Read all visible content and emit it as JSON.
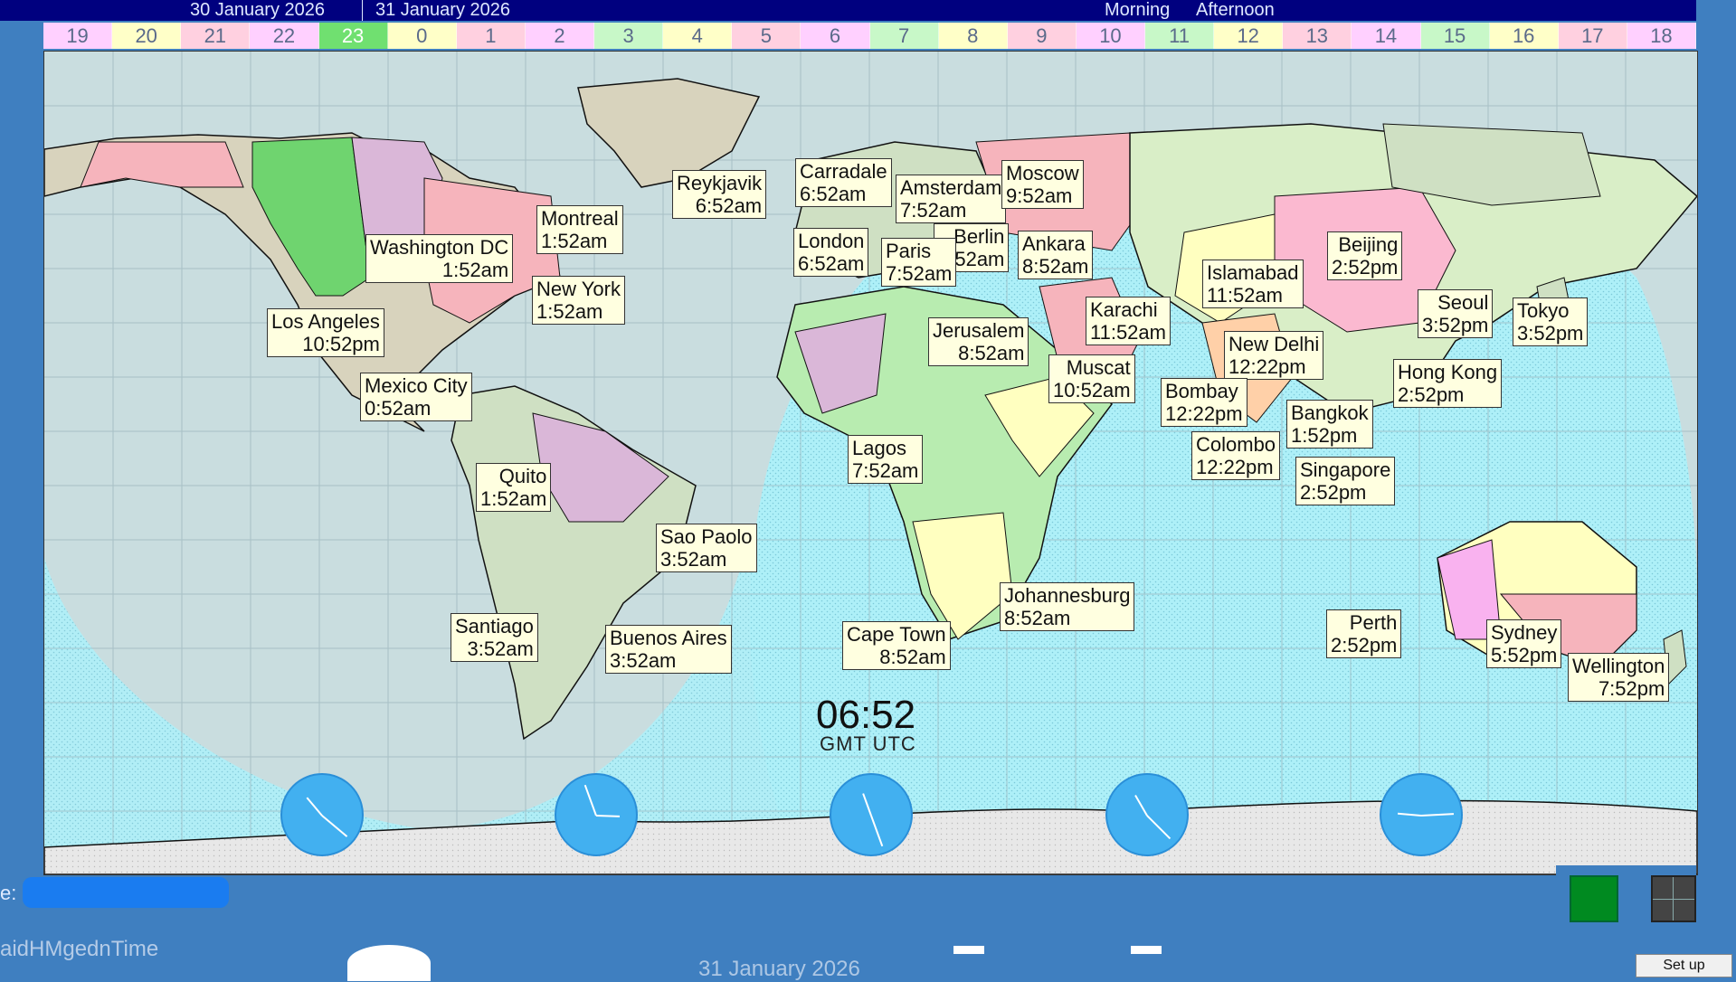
{
  "header": {
    "date_left": "30 January 2026",
    "date_right": "31 January 2026",
    "period_morning": "Morning",
    "period_afternoon": "Afternoon"
  },
  "hour_strip": [
    "19",
    "20",
    "21",
    "22",
    "23",
    "0",
    "1",
    "2",
    "3",
    "4",
    "5",
    "6",
    "7",
    "8",
    "9",
    "10",
    "11",
    "12",
    "13",
    "14",
    "15",
    "16",
    "17",
    "18"
  ],
  "cities": [
    {
      "name": "Reykjavik",
      "time": "6:52am"
    },
    {
      "name": "Carradale",
      "time": "6:52am"
    },
    {
      "name": "Amsterdam",
      "time": "7:52am"
    },
    {
      "name": "Moscow",
      "time": "9:52am"
    },
    {
      "name": "Montreal",
      "time": "1:52am"
    },
    {
      "name": "Washington DC",
      "time": "1:52am"
    },
    {
      "name": "New York",
      "time": "1:52am"
    },
    {
      "name": "Los Angeles",
      "time": "10:52pm"
    },
    {
      "name": "Mexico City",
      "time": "0:52am"
    },
    {
      "name": "London",
      "time": "6:52am"
    },
    {
      "name": "Paris",
      "time": "7:52am"
    },
    {
      "name": "Berlin",
      "time": "7:52am"
    },
    {
      "name": "Ankara",
      "time": "8:52am"
    },
    {
      "name": "Jerusalem",
      "time": "8:52am"
    },
    {
      "name": "Karachi",
      "time": "11:52am"
    },
    {
      "name": "Islamabad",
      "time": "11:52am"
    },
    {
      "name": "Beijing",
      "time": "2:52pm"
    },
    {
      "name": "Seoul",
      "time": "3:52pm"
    },
    {
      "name": "Tokyo",
      "time": "3:52pm"
    },
    {
      "name": "New Delhi",
      "time": "12:22pm"
    },
    {
      "name": "Muscat",
      "time": "10:52am"
    },
    {
      "name": "Bombay",
      "time": "12:22pm"
    },
    {
      "name": "Hong Kong",
      "time": "2:52pm"
    },
    {
      "name": "Bangkok",
      "time": "1:52pm"
    },
    {
      "name": "Colombo",
      "time": "12:22pm"
    },
    {
      "name": "Singapore",
      "time": "2:52pm"
    },
    {
      "name": "Quito",
      "time": "1:52am"
    },
    {
      "name": "Lagos",
      "time": "7:52am"
    },
    {
      "name": "Sao Paolo",
      "time": "3:52am"
    },
    {
      "name": "Johannesburg",
      "time": "8:52am"
    },
    {
      "name": "Santiago",
      "time": "3:52am"
    },
    {
      "name": "Buenos Aires",
      "time": "3:52am"
    },
    {
      "name": "Cape Town",
      "time": "8:52am"
    },
    {
      "name": "Perth",
      "time": "2:52pm"
    },
    {
      "name": "Sydney",
      "time": "5:52pm"
    },
    {
      "name": "Wellington",
      "time": "7:52pm"
    }
  ],
  "gmt": {
    "time": "06:52",
    "label": "GMT  UTC"
  },
  "footer": {
    "left_label": "e:",
    "mode_text": "aidHMgednTime",
    "date": "31 January 2026",
    "setup_label": "Set up"
  },
  "colors": {
    "background": "#3f7fc0",
    "header_bar": "#00007f",
    "night": "#c9dddf",
    "day_ocean": "#aef0f8",
    "label_bg": "#ffffe0"
  }
}
